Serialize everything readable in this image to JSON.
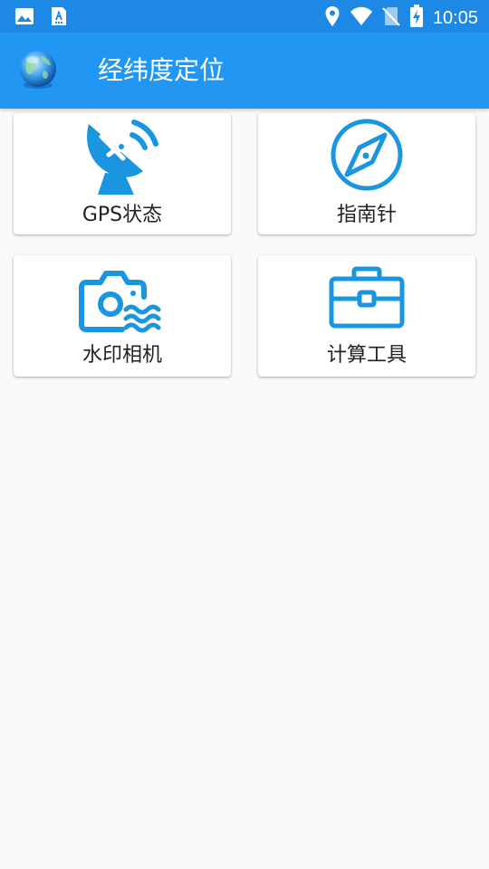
{
  "status_bar": {
    "time": "10:05",
    "left_icons": [
      "image-notification-icon",
      "text-a-notification-icon"
    ],
    "right_icons": [
      "location-icon",
      "wifi-icon",
      "no-sim-icon",
      "battery-charging-icon"
    ]
  },
  "app_bar": {
    "title": "经纬度定位",
    "logo": "globe-logo",
    "background": "#2196f3"
  },
  "menu": {
    "items": [
      {
        "label": "GPS状态",
        "icon": "satellite-dish-icon"
      },
      {
        "label": "指南针",
        "icon": "compass-icon"
      },
      {
        "label": "水印相机",
        "icon": "watermark-camera-icon"
      },
      {
        "label": "计算工具",
        "icon": "toolbox-icon"
      }
    ]
  },
  "colors": {
    "status_bar": "#1e88e5",
    "accent_icon": "#1a96e0",
    "background": "#fafafa"
  }
}
